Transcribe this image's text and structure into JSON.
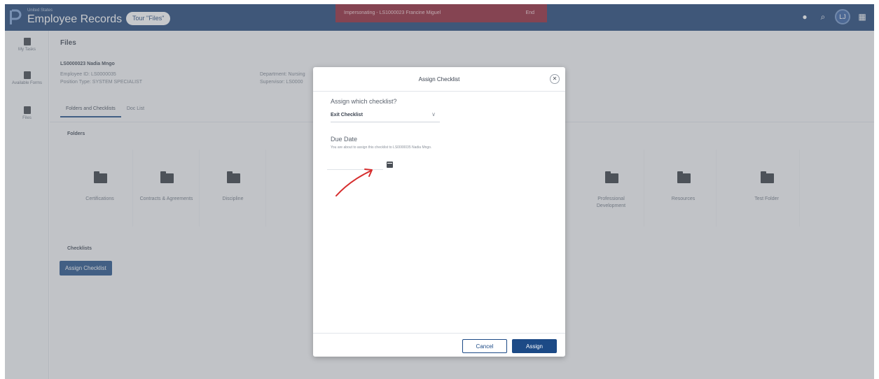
{
  "app": {
    "brand_sub": "United States",
    "title": "Employee Records",
    "tour_button": "Tour \"Files\"",
    "impersonation_message": "Impersonating - LS1000023 Francine Miguel",
    "impersonation_end": "End",
    "avatar_initial": "LJ"
  },
  "left_nav": [
    {
      "label": "My Tasks",
      "icon": "checkbox-icon"
    },
    {
      "label": "Available Forms",
      "icon": "document-icon"
    },
    {
      "label": "Files",
      "icon": "folder-icon"
    }
  ],
  "page": {
    "title": "Files",
    "employee_name": "LS0000023 Nadia Mngo",
    "employee_id": "Employee ID: LS0000035",
    "position_type": "Position Type: SYSTEM SPECIALIST",
    "department": "Department: Nursing",
    "supervisor": "Supervisor: LS0000",
    "tabs": [
      "Folders and Checklists",
      "Doc List"
    ],
    "folders_label": "Folders",
    "folders": [
      "Certifications",
      "Contracts & Agreements",
      "Discipline",
      "Professional Development",
      "Resources",
      "Test Folder"
    ],
    "checklists_label": "Checklists",
    "assign_checklist_button": "Assign Checklist"
  },
  "modal": {
    "title": "Assign Checklist",
    "question": "Assign which checklist?",
    "selected_checklist": "Exit Checklist",
    "due_date_label": "Due Date",
    "due_date_note": "You are about to assign this checklist to LS0000035 Nadia Mngo.",
    "date_value": "",
    "cancel_label": "Cancel",
    "assign_label": "Assign",
    "annotation_color": "#d62d2d"
  }
}
